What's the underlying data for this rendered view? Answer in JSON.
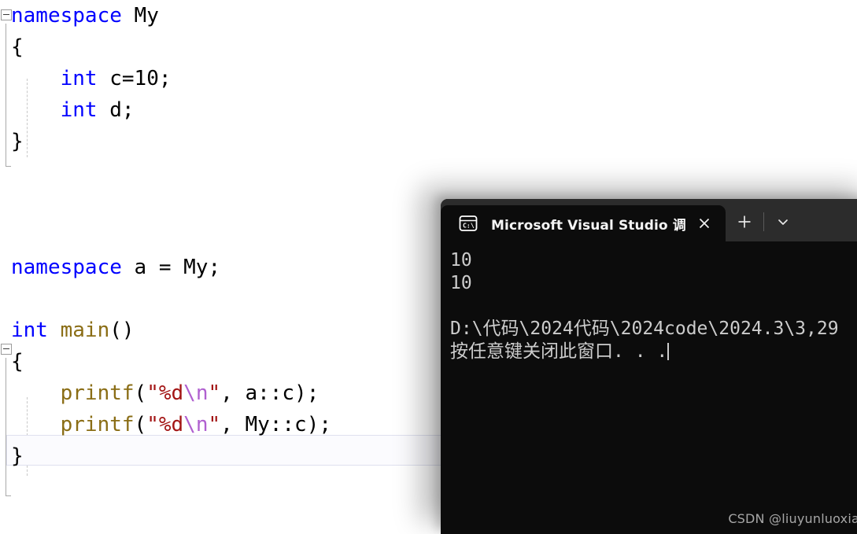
{
  "editor": {
    "lines": [
      {
        "id": "ns-my-open",
        "segments": [
          {
            "t": "namespace ",
            "c": "kw"
          },
          {
            "t": "My",
            "c": "plain"
          }
        ]
      },
      {
        "id": "brace-open-1",
        "segments": [
          {
            "t": "{",
            "c": "plain"
          }
        ]
      },
      {
        "id": "int-c",
        "segments": [
          {
            "t": "    ",
            "c": "plain"
          },
          {
            "t": "int",
            "c": "kw"
          },
          {
            "t": " c=10;",
            "c": "plain"
          }
        ]
      },
      {
        "id": "int-d",
        "segments": [
          {
            "t": "    ",
            "c": "plain"
          },
          {
            "t": "int",
            "c": "kw"
          },
          {
            "t": " d;",
            "c": "plain"
          }
        ]
      },
      {
        "id": "brace-close-1",
        "segments": [
          {
            "t": "}",
            "c": "plain"
          }
        ]
      },
      {
        "id": "blank-1",
        "segments": []
      },
      {
        "id": "blank-2",
        "segments": []
      },
      {
        "id": "blank-3",
        "segments": []
      },
      {
        "id": "ns-alias",
        "segments": [
          {
            "t": "namespace",
            "c": "kw"
          },
          {
            "t": " a = My;",
            "c": "plain"
          }
        ]
      },
      {
        "id": "blank-4",
        "segments": []
      },
      {
        "id": "int-main",
        "segments": [
          {
            "t": "int",
            "c": "kw"
          },
          {
            "t": " ",
            "c": "plain"
          },
          {
            "t": "main",
            "c": "fn"
          },
          {
            "t": "()",
            "c": "plain"
          }
        ]
      },
      {
        "id": "brace-open-2",
        "segments": [
          {
            "t": "{",
            "c": "plain"
          }
        ]
      },
      {
        "id": "printf-a",
        "segments": [
          {
            "t": "    ",
            "c": "plain"
          },
          {
            "t": "printf",
            "c": "fn"
          },
          {
            "t": "(",
            "c": "plain"
          },
          {
            "t": "\"%d",
            "c": "str"
          },
          {
            "t": "\\n",
            "c": "esc"
          },
          {
            "t": "\"",
            "c": "str"
          },
          {
            "t": ", a::c);",
            "c": "plain"
          }
        ]
      },
      {
        "id": "printf-my",
        "segments": [
          {
            "t": "    ",
            "c": "plain"
          },
          {
            "t": "printf",
            "c": "fn"
          },
          {
            "t": "(",
            "c": "plain"
          },
          {
            "t": "\"%d",
            "c": "str"
          },
          {
            "t": "\\n",
            "c": "esc"
          },
          {
            "t": "\"",
            "c": "str"
          },
          {
            "t": ", My::c);",
            "c": "plain"
          }
        ]
      },
      {
        "id": "brace-close-2",
        "segments": [
          {
            "t": "}",
            "c": "plain"
          }
        ]
      }
    ],
    "current_line_id": "printf-my",
    "colors": {
      "keyword": "#0000ff",
      "function": "#8a6d15",
      "string": "#a31515",
      "escape": "#b060d0",
      "text": "#000000",
      "background": "#ffffff",
      "current_line_border": "#dfe1ef"
    }
  },
  "terminal": {
    "tab": {
      "title": "Microsoft Visual Studio 调试控",
      "icon": "command-prompt-icon",
      "close_label": "✕"
    },
    "new_tab_label": "+",
    "dropdown_label": "⌄",
    "background": "#0c0c0c",
    "titlebar_background": "#2c2c2c",
    "output": [
      {
        "id": "out-1",
        "text": "10"
      },
      {
        "id": "out-2",
        "text": "10"
      },
      {
        "id": "out-gap",
        "text": ""
      },
      {
        "id": "out-path",
        "text": "D:\\代码\\2024代码\\2024code\\2024.3\\3,29"
      },
      {
        "id": "out-prompt",
        "text": "按任意键关闭此窗口. . ."
      }
    ]
  },
  "watermark": {
    "text": "CSDN @liuyunluoxiao"
  }
}
